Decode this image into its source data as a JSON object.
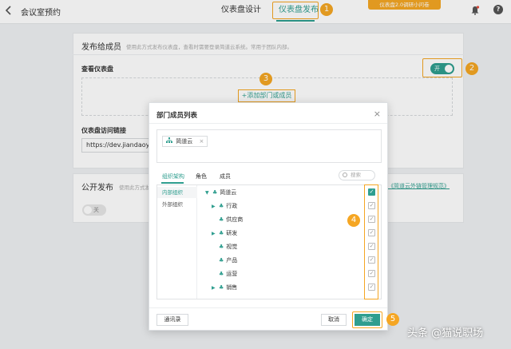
{
  "topbar": {
    "app_title": "会议室预约",
    "tabs": [
      {
        "label": "仪表盘设计",
        "active": false
      },
      {
        "label": "仪表盘发布",
        "active": true
      }
    ],
    "promo": "仪表盘2.0调研小问卷",
    "back_icon": "chevron-left-icon",
    "bell_icon": "bell-icon",
    "help_icon": "help-icon",
    "help_glyph": "?"
  },
  "publish_members": {
    "title": "发布给成员",
    "subtitle": "使用此方式发布仪表盘，查看时需要登录简道云系统。常用于团队内部。",
    "view_label": "查看仪表盘",
    "toggle_label": "开",
    "add_button": "+添加部门或成员",
    "link_label": "仪表盘访问链接",
    "link_value": "https://dev.jiandaoyun"
  },
  "public_publish": {
    "title": "公开发布",
    "subtitle": "使用此方式发",
    "toggle_label": "关",
    "ext_link": "《简道云外链管理规范》"
  },
  "modal": {
    "title": "部门成员列表",
    "close_glyph": "×",
    "selected_chip": "简道云",
    "tabs": [
      "组织架构",
      "角色",
      "成员"
    ],
    "search_placeholder": "搜索",
    "side_items": [
      "内部组织",
      "外部组织"
    ],
    "tree": [
      {
        "label": "简道云",
        "expandable": true,
        "expanded": true,
        "checked": true
      },
      {
        "label": "行政",
        "expandable": true,
        "expanded": false,
        "checked": true
      },
      {
        "label": "供应商",
        "expandable": false,
        "expanded": false,
        "checked": true
      },
      {
        "label": "研发",
        "expandable": true,
        "expanded": false,
        "checked": true
      },
      {
        "label": "视觉",
        "expandable": false,
        "expanded": false,
        "checked": true
      },
      {
        "label": "产品",
        "expandable": false,
        "expanded": false,
        "checked": true
      },
      {
        "label": "运营",
        "expandable": false,
        "expanded": false,
        "checked": true
      },
      {
        "label": "销售",
        "expandable": true,
        "expanded": false,
        "checked": true
      }
    ],
    "contacts_button": "通讯录",
    "cancel_button": "取消",
    "confirm_button": "确定"
  },
  "annotations": [
    "1",
    "2",
    "3",
    "4",
    "5"
  ],
  "watermark": "头条 @猫说职场",
  "colors": {
    "accent": "#2f9e8f",
    "highlight": "#f5a623"
  }
}
